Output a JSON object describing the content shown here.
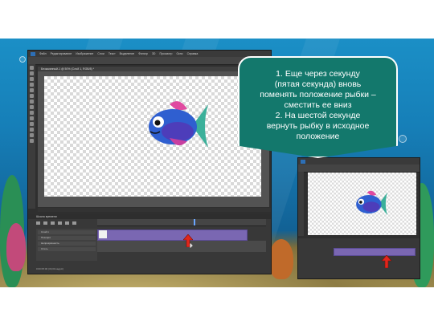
{
  "callout": {
    "line1": "1.    Еще через секунду",
    "line2": "(пятая секунда) вновь",
    "line3": "поменять положение рыбки –",
    "line4": "сместить ее вниз",
    "line5": "2. На шестой секунде",
    "line6": "вернуть рыбку в исходное",
    "line7": "положение"
  },
  "photoshop": {
    "menu": [
      "Файл",
      "Редактирование",
      "Изображение",
      "Слои",
      "Текст",
      "Выделение",
      "Фильтр",
      "3D",
      "Просмотр",
      "Окно",
      "Справка"
    ],
    "tab_title": "Безымянный-1 @ 50% (Слой 1, RGB/8) *",
    "timeline_label": "Шкала времени",
    "layer_name": "Слой 1",
    "sublayer_items": [
      "Позиция",
      "Непрозрачность",
      "Стиль"
    ],
    "frame_rate": "0:00:05:00",
    "fps": "(30,00 кадр/с)"
  },
  "colors": {
    "callout_bg": "#13786c",
    "track": "#7a67b2",
    "arrow_red": "#e1261c"
  }
}
